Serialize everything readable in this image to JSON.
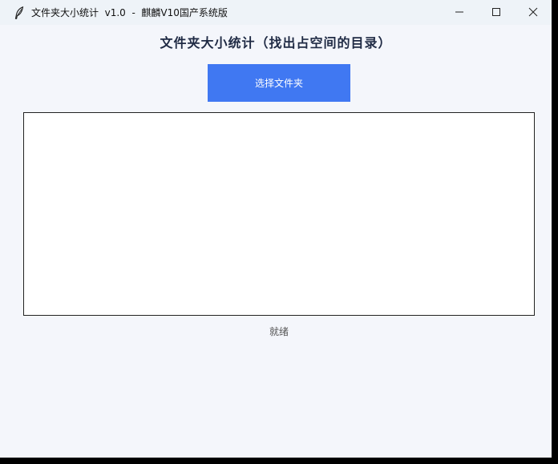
{
  "window": {
    "title": "文件夹大小统计  v1.0  -  麒麟V10国产系统版",
    "controls": {
      "minimize_icon": "minimize-icon",
      "maximize_icon": "maximize-icon",
      "close_icon": "close-icon"
    }
  },
  "main": {
    "heading": "文件夹大小统计（找出占空间的目录）",
    "select_button_label": "选择文件夹",
    "result_text": "",
    "status_text": "就绪"
  },
  "colors": {
    "accent": "#4078f2",
    "background": "#f4f6fb",
    "titlebar": "#eef3f8",
    "heading": "#1f2a44"
  }
}
